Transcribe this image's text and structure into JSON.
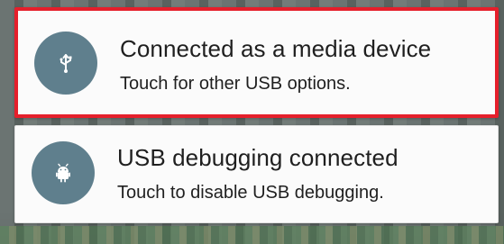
{
  "notifications": [
    {
      "icon": "usb-icon",
      "title": "Connected as a media device",
      "subtitle": "Touch for other USB options.",
      "highlighted": true,
      "highlight_color": "#e51f2b",
      "icon_color": "#5f7f8d"
    },
    {
      "icon": "android-debug-icon",
      "title": "USB debugging connected",
      "subtitle": "Touch to disable USB debugging.",
      "highlighted": false,
      "icon_color": "#5f7f8d"
    }
  ]
}
